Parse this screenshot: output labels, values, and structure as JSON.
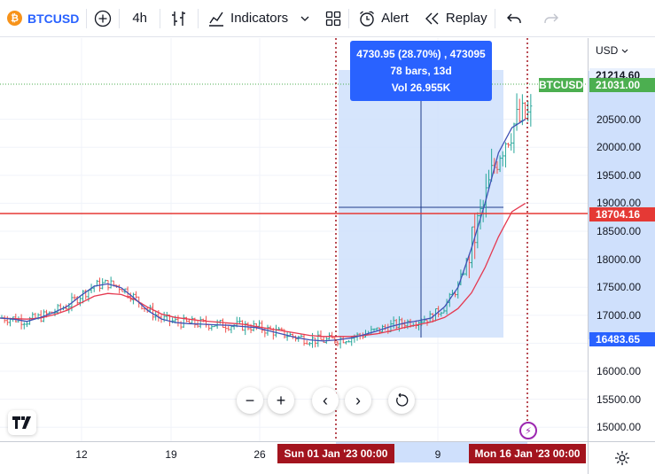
{
  "toolbar": {
    "symbol": "BTCUSD",
    "symbol_icon": "₿",
    "interval": "4h",
    "indicators_label": "Indicators",
    "alert_label": "Alert",
    "replay_label": "Replay"
  },
  "price_scale": {
    "currency": "USD",
    "ticks": [
      "20500.00",
      "20000.00",
      "19500.00",
      "19000.00",
      "18500.00",
      "18000.00",
      "17500.00",
      "17000.00",
      "16500.00",
      "16000.00",
      "15500.00",
      "15000.00"
    ],
    "labels": {
      "high": "21214.60",
      "last": "21031.00",
      "hline": "18704.16",
      "range_low": "16483.65"
    }
  },
  "symbol_tag": "BTCUSD",
  "measure": {
    "line1": "4730.95 (28.70%) , 473095",
    "line2": "78 bars, 13d",
    "line3": "Vol 26.955K"
  },
  "time_scale": {
    "ticks": [
      "12",
      "19",
      "26",
      "9"
    ],
    "range_start": "Sun 01 Jan '23   00:00",
    "range_end": "Mon 16 Jan '23   00:00"
  },
  "colors": {
    "up": "#26a69a",
    "down": "#ef5350",
    "hline": "#e53935",
    "last_price": "#4caf50",
    "measure": "#2962ff",
    "ma_fast": "#3f51b5",
    "ma_slow": "#e53950"
  },
  "chart_data": {
    "type": "candlestick",
    "price_axis": {
      "min": 14750,
      "max": 21950
    },
    "horizontal_line": 18704.16,
    "measure_range": {
      "from": 16483.65,
      "to": 21214.6,
      "change": 4730.95,
      "percent": 28.7,
      "bars": 78,
      "days": 13
    },
    "series": [
      {
        "name": "fast_ma",
        "values": [
          16950,
          16930,
          16890,
          16960,
          17050,
          17160,
          17350,
          17520,
          17560,
          17490,
          17300,
          17080,
          16930,
          16870,
          16850,
          16840,
          16830,
          16820,
          16800,
          16780,
          16720,
          16660,
          16600,
          16560,
          16540,
          16560,
          16590,
          16650,
          16720,
          16800,
          16860,
          16900,
          16950,
          17150,
          17500,
          18200,
          19000,
          19900,
          20350,
          20500
        ]
      },
      {
        "name": "slow_ma",
        "values": [
          16950,
          16940,
          16930,
          16950,
          17010,
          17090,
          17220,
          17340,
          17390,
          17370,
          17280,
          17140,
          17020,
          16960,
          16930,
          16900,
          16880,
          16860,
          16840,
          16800,
          16760,
          16720,
          16680,
          16640,
          16620,
          16620,
          16620,
          16640,
          16670,
          16720,
          16780,
          16830,
          16880,
          16960,
          17120,
          17400,
          17850,
          18400,
          18850,
          19000
        ]
      }
    ]
  }
}
